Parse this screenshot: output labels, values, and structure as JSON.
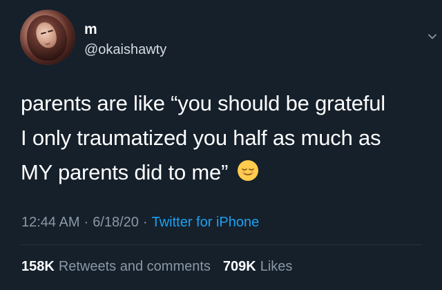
{
  "tweet": {
    "author": {
      "name": "m",
      "handle": "@okaishawty"
    },
    "text_lines": [
      "parents are like “you should be grateful",
      "I only traumatized you half as much as",
      "MY parents did to me”"
    ],
    "emoji": "relieved-face",
    "meta": {
      "time": "12:44 AM",
      "separator_1": "·",
      "date": "6/18/20",
      "separator_2": "·",
      "source": "Twitter for iPhone"
    },
    "stats": {
      "retweets_count": "158K",
      "retweets_label": "Retweets and comments",
      "likes_count": "709K",
      "likes_label": "Likes"
    }
  },
  "icons": {
    "chevron": "chevron-down-icon",
    "avatar": "avatar"
  },
  "colors": {
    "background": "#15202b",
    "text": "#ffffff",
    "secondary_text": "#8b98a5",
    "link": "#1da1f2",
    "divider": "#253341"
  }
}
